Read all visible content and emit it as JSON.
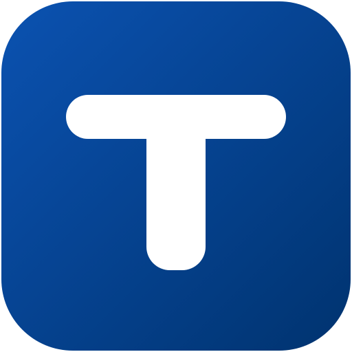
{
  "icon": {
    "name": "t-letter-icon",
    "letter": "T",
    "colors": {
      "background_gradient_start": "#0B52B1",
      "background_gradient_end": "#00336F",
      "glyph": "#FFFFFF"
    }
  }
}
